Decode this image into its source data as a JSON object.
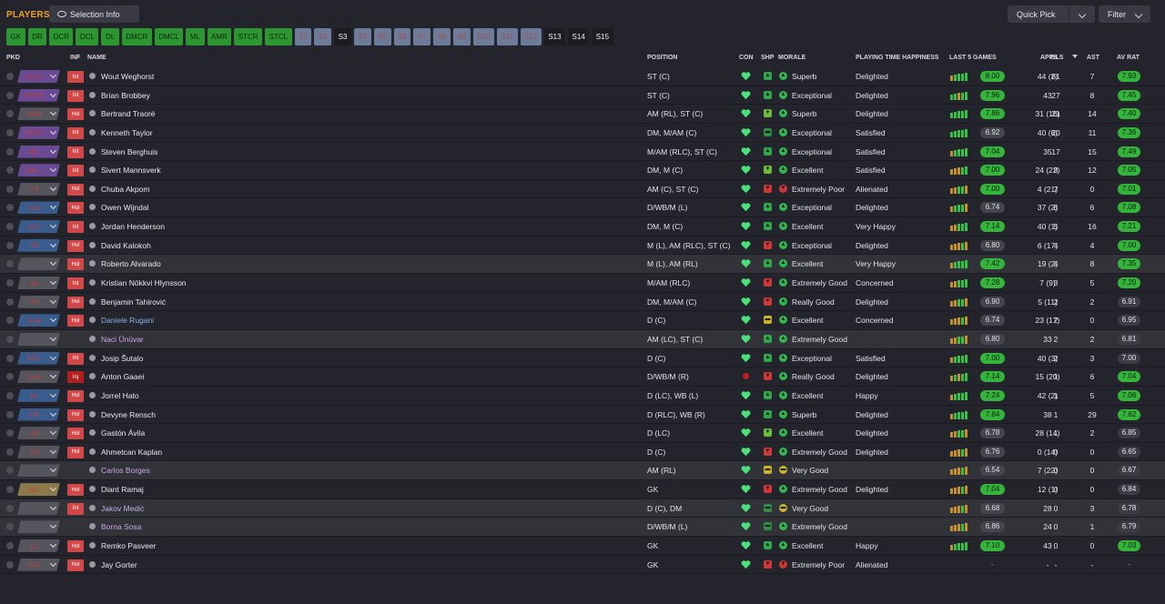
{
  "header": {
    "title": "PLAYERS",
    "selection_info": "Selection Info",
    "quick_pick": "Quick Pick",
    "filter": "Filter"
  },
  "positions": [
    {
      "label": "GK",
      "style": "g"
    },
    {
      "label": "DR",
      "style": "g"
    },
    {
      "label": "DCR",
      "style": "g"
    },
    {
      "label": "DCL",
      "style": "g"
    },
    {
      "label": "DL",
      "style": "g"
    },
    {
      "label": "DMCR",
      "style": "g"
    },
    {
      "label": "DMCL",
      "style": "g"
    },
    {
      "label": "ML",
      "style": "g"
    },
    {
      "label": "AMR",
      "style": "g"
    },
    {
      "label": "STCR",
      "style": "g"
    },
    {
      "label": "STCL",
      "style": "g"
    },
    {
      "label": "S1",
      "style": "b"
    },
    {
      "label": "S2",
      "style": "b"
    },
    {
      "label": "S3",
      "style": "s"
    },
    {
      "label": "S4",
      "style": "b"
    },
    {
      "label": "S5",
      "style": "b"
    },
    {
      "label": "S6",
      "style": "b"
    },
    {
      "label": "S7",
      "style": "b"
    },
    {
      "label": "S8",
      "style": "b"
    },
    {
      "label": "S9",
      "style": "b"
    },
    {
      "label": "S10",
      "style": "b"
    },
    {
      "label": "S11",
      "style": "b"
    },
    {
      "label": "S12",
      "style": "b"
    },
    {
      "label": "S13",
      "style": "s"
    },
    {
      "label": "S14",
      "style": "s"
    },
    {
      "label": "S15",
      "style": "s"
    }
  ],
  "columns": {
    "pkd": "PKD",
    "inf": "INF",
    "name": "NAME",
    "position": "POSITION",
    "con": "CON",
    "shp": "SHP",
    "morale": "MORALE",
    "pth": "PLAYING TIME HAPPINESS",
    "last5": "LAST 5 GAMES",
    "apps": "APPS",
    "gls": "GLS",
    "ast": "AST",
    "avrat": "AV RAT"
  },
  "colors": {
    "green_badge": "#30b030",
    "grey_badge": "#4a4a52",
    "heart": "#4ae07a",
    "pkd_purple": "#6a4a92",
    "pkd_blue": "#3a5c8c",
    "pkd_grey": "#55555d",
    "pkd_gold": "#8c7a4a",
    "int": "#d24848",
    "hol": "#d24848",
    "inj": "#b02a2a"
  },
  "players": [
    {
      "pkd": "STCL",
      "pkd_color": "pkd_purple",
      "inf": "Int",
      "name": "Wout Weghorst",
      "name_color": "#e8e8ee",
      "position": "ST (C)",
      "shp": "up",
      "morale": "Superb",
      "morale_icon": "up2",
      "pth": "Delighted",
      "last5": [
        "o",
        "g",
        "g",
        "g",
        "g"
      ],
      "l5rat": "8.00",
      "l5g": true,
      "apps": "44 (2)",
      "gls": "61",
      "ast": "7",
      "av": "7.93",
      "avg": true
    },
    {
      "pkd": "STCR",
      "pkd_color": "pkd_purple",
      "inf": "Int",
      "name": "Brian Brobbey",
      "name_color": "#e8e8ee",
      "position": "ST (C)",
      "shp": "up",
      "morale": "Exceptional",
      "morale_icon": "up2",
      "pth": "Delighted",
      "last5": [
        "g",
        "g",
        "o",
        "g",
        "g"
      ],
      "l5rat": "7.96",
      "l5g": true,
      "apps": "43",
      "gls": "27",
      "ast": "8",
      "av": "7.45",
      "avg": true
    },
    {
      "pkd": "AMR",
      "pkd_color": "pkd_grey",
      "inf": "Hol",
      "name": "Bertrand Traoré",
      "name_color": "#e8e8ee",
      "position": "AM (RL), ST (C)",
      "shp": "down",
      "morale": "Superb",
      "morale_icon": "up2",
      "pth": "Delighted",
      "last5": [
        "g",
        "g",
        "g",
        "g",
        "g"
      ],
      "l5rat": "7.86",
      "l5g": true,
      "apps": "31 (16)",
      "gls": "21",
      "ast": "14",
      "av": "7.40",
      "avg": true
    },
    {
      "pkd": "DMCL",
      "pkd_color": "pkd_purple",
      "inf": "Int",
      "name": "Kenneth Taylor",
      "name_color": "#e8e8ee",
      "position": "DM, M/AM (C)",
      "shp": "flat",
      "morale": "Exceptional",
      "morale_icon": "up2",
      "pth": "Satisfied",
      "last5": [
        "g",
        "g",
        "g",
        "g",
        "g"
      ],
      "l5rat": "6.92",
      "l5g": false,
      "apps": "40 (6)",
      "gls": "20",
      "ast": "11",
      "av": "7.36",
      "avg": true
    },
    {
      "pkd": "ML",
      "pkd_color": "pkd_purple",
      "inf": "Int",
      "name": "Steven Berghuis",
      "name_color": "#e8e8ee",
      "position": "M/AM (RLC), ST (C)",
      "shp": "up",
      "morale": "Exceptional",
      "morale_icon": "up2",
      "pth": "Satisfied",
      "last5": [
        "o",
        "g",
        "g",
        "g",
        "g"
      ],
      "l5rat": "7.04",
      "l5g": true,
      "apps": "35",
      "gls": "17",
      "ast": "15",
      "av": "7.49",
      "avg": true
    },
    {
      "pkd": "DM...",
      "pkd_color": "pkd_purple",
      "inf": "Int",
      "name": "Sivert Mannsverk",
      "name_color": "#e8e8ee",
      "position": "DM, M (C)",
      "shp": "down",
      "morale": "Excellent",
      "morale_icon": "up",
      "pth": "Satisfied",
      "last5": [
        "o",
        "o",
        "o",
        "g",
        "g"
      ],
      "l5rat": "7.00",
      "l5g": true,
      "apps": "24 (22)",
      "gls": "8",
      "ast": "12",
      "av": "7.05",
      "avg": true
    },
    {
      "pkd": "S4",
      "pkd_color": "pkd_grey",
      "inf": "Hol",
      "name": "Chuba Akpom",
      "name_color": "#e8e8ee",
      "position": "AM (C), ST (C)",
      "shp": "red",
      "morale": "Extremely Poor",
      "morale_icon": "down2",
      "pth": "Alienated",
      "last5": [
        "o",
        "o",
        "g",
        "g",
        "o"
      ],
      "l5rat": "7.00",
      "l5g": true,
      "apps": "4 (21)",
      "gls": "7",
      "ast": "0",
      "av": "7.01",
      "avg": true
    },
    {
      "pkd": "S10",
      "pkd_color": "pkd_blue",
      "inf": "Hol",
      "name": "Owen Wijndal",
      "name_color": "#e8e8ee",
      "position": "D/WB/M (L)",
      "shp": "up",
      "morale": "Exceptional",
      "morale_icon": "up2",
      "pth": "Delighted",
      "last5": [
        "o",
        "g",
        "g",
        "g",
        "o"
      ],
      "l5rat": "6.74",
      "l5g": false,
      "apps": "37 (2)",
      "gls": "6",
      "ast": "6",
      "av": "7.08",
      "avg": true
    },
    {
      "pkd": "S12",
      "pkd_color": "pkd_blue",
      "inf": "Int",
      "name": "Jordan Henderson",
      "name_color": "#e8e8ee",
      "position": "DM, M (C)",
      "shp": "up",
      "morale": "Excellent",
      "morale_icon": "up",
      "pth": "Very Happy",
      "last5": [
        "o",
        "o",
        "g",
        "g",
        "g"
      ],
      "l5rat": "7.14",
      "l5g": true,
      "apps": "40 (1)",
      "gls": "5",
      "ast": "16",
      "av": "7.21",
      "avg": true
    },
    {
      "pkd": "S5",
      "pkd_color": "pkd_blue",
      "inf": "Hol",
      "name": "David Kalokoh",
      "name_color": "#e8e8ee",
      "position": "M (L), AM (RLC), ST (C)",
      "shp": "red",
      "morale": "Exceptional",
      "morale_icon": "up2",
      "pth": "Delighted",
      "last5": [
        "o",
        "o",
        "o",
        "g",
        "o"
      ],
      "l5rat": "6.80",
      "l5g": false,
      "apps": "6 (17)",
      "gls": "4",
      "ast": "4",
      "av": "7.00",
      "avg": true
    },
    {
      "pkd": "-",
      "pkd_color": "pkd_grey",
      "inf": "Hol",
      "name": "Roberto Alvarado",
      "name_color": "#e8e8ee",
      "position": "M (L), AM (RL)",
      "shp": "up",
      "morale": "Excellent",
      "morale_icon": "up",
      "pth": "Very Happy",
      "last5": [
        "o",
        "g",
        "g",
        "g",
        "g"
      ],
      "l5rat": "7.42",
      "l5g": true,
      "apps": "19 (2)",
      "gls": "4",
      "ast": "8",
      "av": "7.35",
      "avg": true,
      "alt": true
    },
    {
      "pkd": "S6",
      "pkd_color": "pkd_grey",
      "inf": "Int",
      "name": "Kristian Nökkvi Hlynsson",
      "name_color": "#e8e8ee",
      "position": "M/AM (RLC)",
      "shp": "red",
      "morale": "Extremely Good",
      "morale_icon": "up",
      "pth": "Concerned",
      "last5": [
        "o",
        "o",
        "g",
        "g",
        "g"
      ],
      "l5rat": "7.28",
      "l5g": true,
      "apps": "7 (9)",
      "gls": "3",
      "ast": "5",
      "av": "7.20",
      "avg": true
    },
    {
      "pkd": "S9",
      "pkd_color": "pkd_grey",
      "inf": "Hol",
      "name": "Benjamin Tahirović",
      "name_color": "#e8e8ee",
      "position": "DM, M/AM (C)",
      "shp": "red",
      "morale": "Really Good",
      "morale_icon": "up",
      "pth": "Delighted",
      "last5": [
        "o",
        "o",
        "g",
        "g",
        "o"
      ],
      "l5rat": "6.90",
      "l5g": false,
      "apps": "5 (11)",
      "gls": "2",
      "ast": "2",
      "av": "6.91",
      "avg": false
    },
    {
      "pkd": "SUB",
      "pkd_color": "pkd_blue",
      "inf": "Hol",
      "name": "Daniele Rugani",
      "name_color": "#8ab4e8",
      "position": "D (C)",
      "shp": "yellow",
      "morale": "Excellent",
      "morale_icon": "up",
      "pth": "Concerned",
      "last5": [
        "o",
        "o",
        "o",
        "g",
        "o"
      ],
      "l5rat": "6.74",
      "l5g": false,
      "apps": "23 (17)",
      "gls": "2",
      "ast": "0",
      "av": "6.95",
      "avg": false
    },
    {
      "pkd": "-",
      "pkd_color": "pkd_grey",
      "inf": "",
      "name": "Naci Ünüvar",
      "name_color": "#c8a8e8",
      "position": "AM (LC), ST (C)",
      "shp": "up",
      "morale": "Extremely Good",
      "morale_icon": "up",
      "pth": "",
      "last5": [
        "o",
        "o",
        "g",
        "g",
        "o"
      ],
      "l5rat": "6.80",
      "l5g": false,
      "apps": "33",
      "gls": "2",
      "ast": "2",
      "av": "6.81",
      "avg": false,
      "alt": true
    },
    {
      "pkd": "DCL",
      "pkd_color": "pkd_blue",
      "inf": "Int",
      "name": "Josip Šutalo",
      "name_color": "#e8e8ee",
      "position": "D (C)",
      "shp": "up",
      "morale": "Exceptional",
      "morale_icon": "up2",
      "pth": "Satisfied",
      "last5": [
        "o",
        "g",
        "g",
        "g",
        "g"
      ],
      "l5rat": "7.00",
      "l5g": true,
      "apps": "40 (3)",
      "gls": "2",
      "ast": "3",
      "av": "7.00",
      "avg": false
    },
    {
      "pkd": "SUB",
      "pkd_color": "pkd_grey",
      "inf": "Inj",
      "name": "Anton Gaaei",
      "name_color": "#e8e8ee",
      "position": "D/WB/M (R)",
      "shp": "red",
      "morale": "Really Good",
      "morale_icon": "up",
      "pth": "Delighted",
      "last5": [
        "o",
        "g",
        "o",
        "g",
        "g"
      ],
      "l5rat": "7.14",
      "l5g": true,
      "apps": "15 (20)",
      "gls": "1",
      "ast": "6",
      "av": "7.04",
      "avg": true,
      "injured": true
    },
    {
      "pkd": "DL",
      "pkd_color": "pkd_blue",
      "inf": "Hol",
      "name": "Jorrel Hato",
      "name_color": "#e8e8ee",
      "position": "D (LC), WB (L)",
      "shp": "up",
      "morale": "Excellent",
      "morale_icon": "up",
      "pth": "Happy",
      "last5": [
        "o",
        "g",
        "g",
        "g",
        "g"
      ],
      "l5rat": "7.24",
      "l5g": true,
      "apps": "42 (2)",
      "gls": "1",
      "ast": "5",
      "av": "7.06",
      "avg": true
    },
    {
      "pkd": "DR",
      "pkd_color": "pkd_blue",
      "inf": "Hol",
      "name": "Devyne Rensch",
      "name_color": "#e8e8ee",
      "position": "D (RLC), WB (R)",
      "shp": "up",
      "morale": "Superb",
      "morale_icon": "up2",
      "pth": "Delighted",
      "last5": [
        "o",
        "g",
        "g",
        "g",
        "g"
      ],
      "l5rat": "7.84",
      "l5g": true,
      "apps": "38",
      "gls": "1",
      "ast": "29",
      "av": "7.62",
      "avg": true
    },
    {
      "pkd": "S8",
      "pkd_color": "pkd_grey",
      "inf": "Hol",
      "name": "Gastón Ávila",
      "name_color": "#e8e8ee",
      "position": "D (LC)",
      "shp": "down",
      "morale": "Excellent",
      "morale_icon": "up",
      "pth": "Delighted",
      "last5": [
        "o",
        "o",
        "g",
        "g",
        "o"
      ],
      "l5rat": "6.78",
      "l5g": false,
      "apps": "28 (14)",
      "gls": "1",
      "ast": "2",
      "av": "6.85",
      "avg": false
    },
    {
      "pkd": "S3",
      "pkd_color": "pkd_grey",
      "inf": "Hol",
      "name": "Ahmetcan Kaplan",
      "name_color": "#e8e8ee",
      "position": "D (C)",
      "shp": "red",
      "morale": "Extremely Good",
      "morale_icon": "up",
      "pth": "Delighted",
      "last5": [
        "o",
        "o",
        "o",
        "g",
        "o"
      ],
      "l5rat": "6.76",
      "l5g": false,
      "apps": "0 (14)",
      "gls": "0",
      "ast": "0",
      "av": "6.65",
      "avg": false
    },
    {
      "pkd": "-",
      "pkd_color": "pkd_grey",
      "inf": "",
      "name": "Carlos Borges",
      "name_color": "#c8a8e8",
      "position": "AM (RL)",
      "shp": "yellow",
      "morale": "Very Good",
      "morale_icon": "yellow",
      "pth": "",
      "last5": [
        "o",
        "o",
        "o",
        "g",
        "o"
      ],
      "l5rat": "6.54",
      "l5g": false,
      "apps": "7 (22)",
      "gls": "0",
      "ast": "0",
      "av": "6.67",
      "avg": false,
      "alt": true
    },
    {
      "pkd": "GK",
      "pkd_color": "pkd_gold",
      "inf": "Hol",
      "name": "Diant Ramaj",
      "name_color": "#e8e8ee",
      "position": "GK",
      "shp": "red",
      "morale": "Extremely Good",
      "morale_icon": "up",
      "pth": "Delighted",
      "last5": [
        "o",
        "o",
        "o",
        "g",
        "o"
      ],
      "l5rat": "7.04",
      "l5g": true,
      "apps": "12 (1)",
      "gls": "0",
      "ast": "0",
      "av": "6.84",
      "avg": false
    },
    {
      "pkd": "-",
      "pkd_color": "pkd_grey",
      "inf": "Int",
      "name": "Jakov Medić",
      "name_color": "#c8a8e8",
      "position": "D (C), DM",
      "shp": "flat",
      "morale": "Very Good",
      "morale_icon": "yellow",
      "pth": "",
      "last5": [
        "o",
        "o",
        "o",
        "g",
        "o"
      ],
      "l5rat": "6.68",
      "l5g": false,
      "apps": "28",
      "gls": "0",
      "ast": "3",
      "av": "6.78",
      "avg": false,
      "alt": true
    },
    {
      "pkd": "-",
      "pkd_color": "pkd_grey",
      "inf": "",
      "name": "Borna Sosa",
      "name_color": "#c8a8e8",
      "position": "D/WB/M (L)",
      "shp": "flat",
      "morale": "Extremely Good",
      "morale_icon": "up",
      "pth": "",
      "last5": [
        "o",
        "o",
        "o",
        "g",
        "o"
      ],
      "l5rat": "6.86",
      "l5g": false,
      "apps": "24",
      "gls": "0",
      "ast": "1",
      "av": "6.79",
      "avg": false,
      "alt": true
    },
    {
      "pkd": "S1",
      "pkd_color": "pkd_grey",
      "inf": "Hol",
      "name": "Remko Pasveer",
      "name_color": "#e8e8ee",
      "position": "GK",
      "shp": "up",
      "morale": "Excellent",
      "morale_icon": "up",
      "pth": "Happy",
      "last5": [
        "o",
        "g",
        "g",
        "g",
        "g"
      ],
      "l5rat": "7.10",
      "l5g": true,
      "apps": "43",
      "gls": "0",
      "ast": "0",
      "av": "7.03",
      "avg": true
    },
    {
      "pkd": "S13",
      "pkd_color": "pkd_grey",
      "inf": "Hol",
      "name": "Jay Gorter",
      "name_color": "#e8e8ee",
      "position": "GK",
      "shp": "red",
      "morale": "Extremely Poor",
      "morale_icon": "down2",
      "pth": "Alienated",
      "last5": [],
      "l5rat": "-",
      "l5g": false,
      "apps": "-",
      "gls": "-",
      "ast": "-",
      "av": "-",
      "avg": false,
      "dash": true
    }
  ]
}
